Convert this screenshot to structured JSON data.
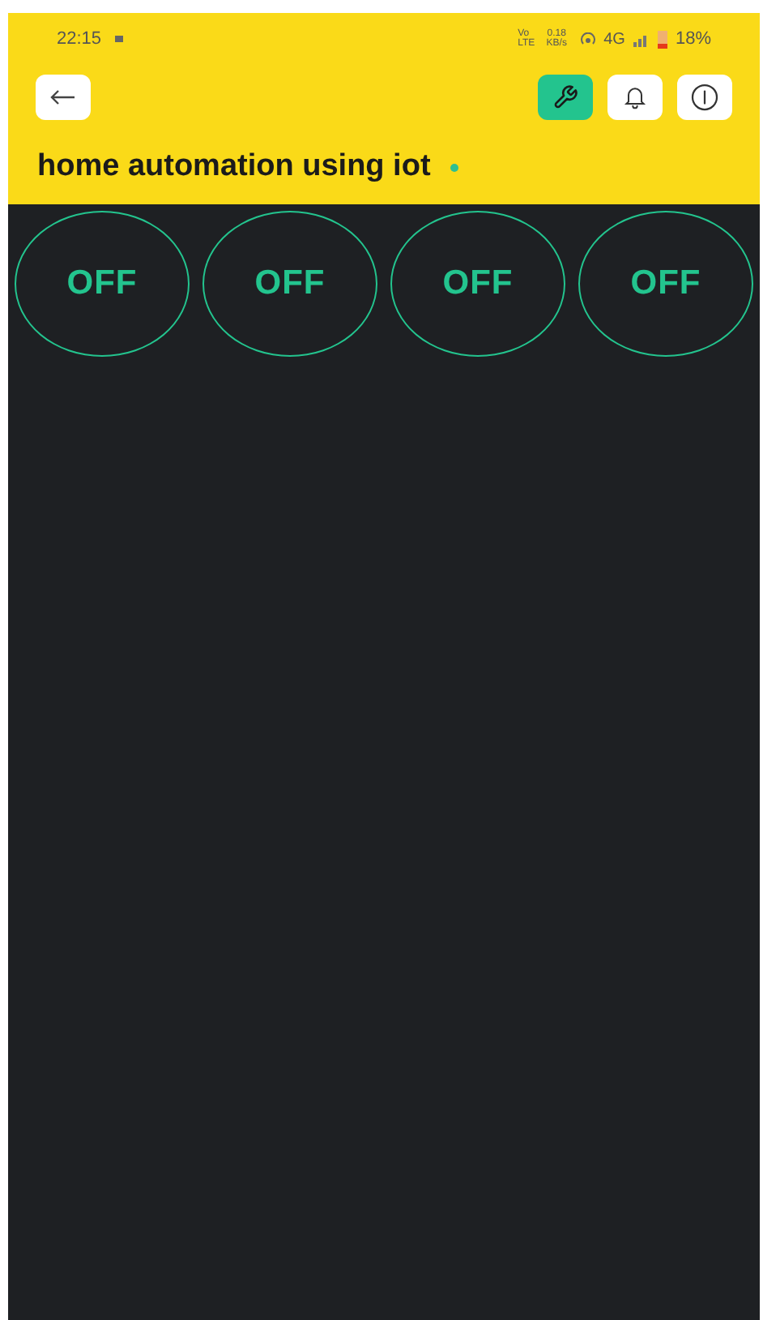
{
  "status_bar": {
    "time": "22:15",
    "volte": "Vo LTE",
    "speed": "0.18 KB/s",
    "network": "4G",
    "battery": "18%"
  },
  "toolbar": {
    "buttons": [
      {
        "kind": "wrench",
        "active": true
      },
      {
        "kind": "bell",
        "active": false
      },
      {
        "kind": "info",
        "active": false
      }
    ]
  },
  "project": {
    "title": "home automation using iot",
    "status_dot": {
      "color": "#2fbf8f"
    }
  },
  "switches": [
    {
      "label": "OFF",
      "on": false
    },
    {
      "label": "OFF",
      "on": false
    },
    {
      "label": "OFF",
      "on": false
    },
    {
      "label": "OFF",
      "on": false
    }
  ]
}
